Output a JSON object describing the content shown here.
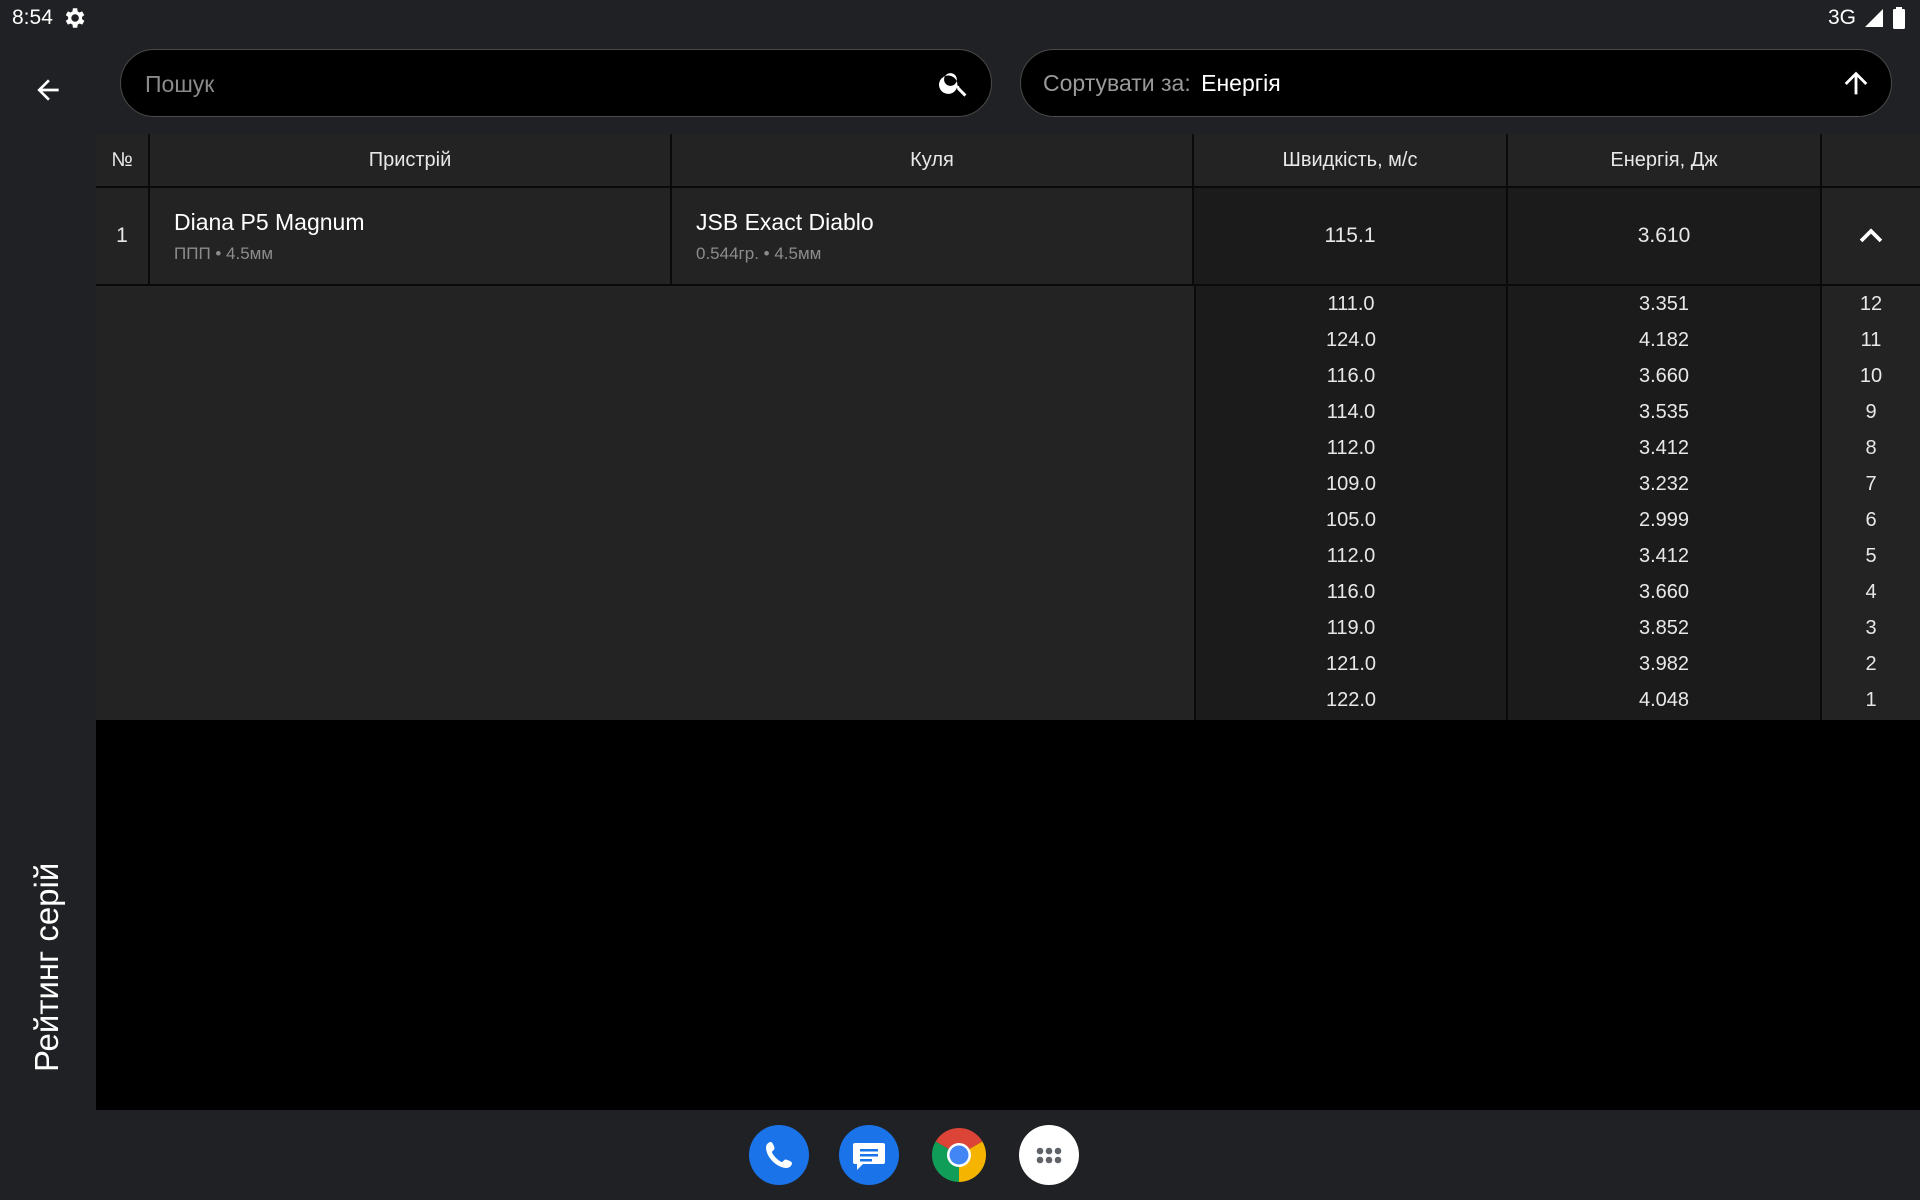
{
  "status_bar": {
    "time": "8:54",
    "network": "3G",
    "icons": [
      "settings-gear-icon",
      "signal-icon",
      "battery-icon"
    ]
  },
  "rail": {
    "back_icon": "arrow-back-icon",
    "title": "Рейтинг серій"
  },
  "search": {
    "placeholder": "Пошук",
    "value": "",
    "icon": "search-icon"
  },
  "sort": {
    "label": "Сортувати за:",
    "value": "Енергія",
    "direction_icon": "arrow-up-icon"
  },
  "table": {
    "headers": {
      "no": "№",
      "device": "Пристрій",
      "bullet": "Куля",
      "speed": "Швидкість, м/с",
      "energy": "Енергія, Дж"
    },
    "rows": [
      {
        "no": "1",
        "device_name": "Diana P5 Magnum",
        "device_sub": "ППП • 4.5мм",
        "bullet_name": "JSB Exact Diablo",
        "bullet_sub": "0.544гр. • 4.5мм",
        "speed": "115.1",
        "energy": "3.610",
        "expanded": true,
        "shots": [
          {
            "speed": "111.0",
            "energy": "3.351",
            "index": "12"
          },
          {
            "speed": "124.0",
            "energy": "4.182",
            "index": "11"
          },
          {
            "speed": "116.0",
            "energy": "3.660",
            "index": "10"
          },
          {
            "speed": "114.0",
            "energy": "3.535",
            "index": "9"
          },
          {
            "speed": "112.0",
            "energy": "3.412",
            "index": "8"
          },
          {
            "speed": "109.0",
            "energy": "3.232",
            "index": "7"
          },
          {
            "speed": "105.0",
            "energy": "2.999",
            "index": "6"
          },
          {
            "speed": "112.0",
            "energy": "3.412",
            "index": "5"
          },
          {
            "speed": "116.0",
            "energy": "3.660",
            "index": "4"
          },
          {
            "speed": "119.0",
            "energy": "3.852",
            "index": "3"
          },
          {
            "speed": "121.0",
            "energy": "3.982",
            "index": "2"
          },
          {
            "speed": "122.0",
            "energy": "4.048",
            "index": "1"
          }
        ]
      }
    ]
  },
  "dock": {
    "apps": [
      "phone-icon",
      "messages-icon",
      "chrome-icon",
      "apps-grid-icon"
    ]
  },
  "colors": {
    "background": "#000000",
    "surface": "#232323",
    "chrome": "#202124",
    "phone": "#1a73e8",
    "messages": "#1a73e8"
  }
}
